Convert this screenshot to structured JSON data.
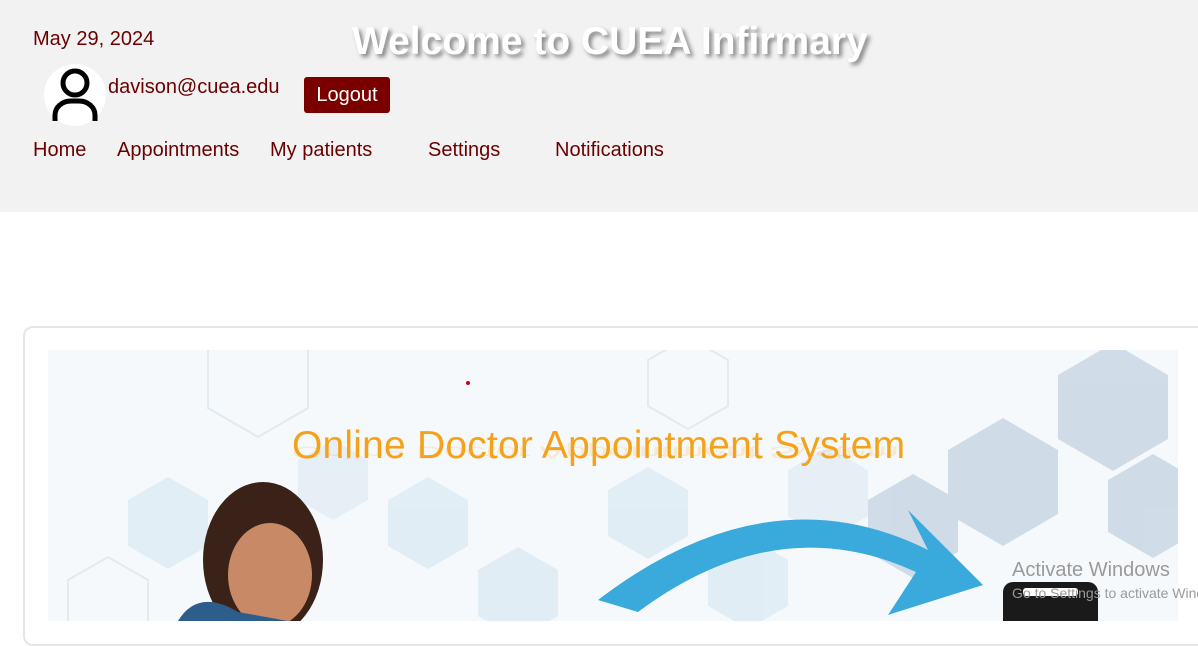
{
  "header": {
    "date": "May 29, 2024",
    "title": "Welcome to CUEA Infirmary",
    "user_email": "davison@cuea.edu",
    "logout_label": "Logout",
    "avatar_icon": "user-icon"
  },
  "nav": {
    "items": [
      {
        "label": "Home"
      },
      {
        "label": "Appointments"
      },
      {
        "label": "My patients"
      },
      {
        "label": "Settings"
      },
      {
        "label": "Notifications"
      }
    ]
  },
  "banner": {
    "title": "Online Doctor Appointment System"
  },
  "watermark": {
    "title": "Activate Windows",
    "subtitle": "Go to Settings to activate Windows."
  },
  "colors": {
    "header_bg": "#f2f2f2",
    "text_maroon": "#6b0000",
    "logout_bg": "#7a0000",
    "banner_title": "#f5a21a",
    "arrow_blue": "#3aa9dc"
  }
}
